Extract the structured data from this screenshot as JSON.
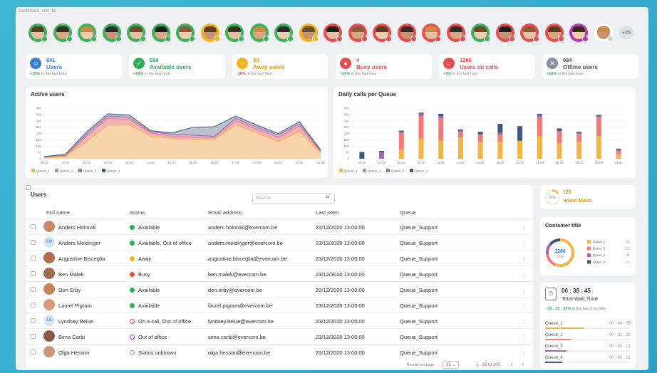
{
  "window_title": "Dashboard_v08_16",
  "avatar_more": "+25",
  "avatars": [
    {
      "status": "#3bb25a"
    },
    {
      "status": "#3bb25a"
    },
    {
      "status": "#3bb25a"
    },
    {
      "status": "#3bb25a"
    },
    {
      "status": "#3bb25a"
    },
    {
      "status": "#3bb25a"
    },
    {
      "status": "#3bb25a"
    },
    {
      "status": "#f1b31c"
    },
    {
      "status": "#3bb25a"
    },
    {
      "status": "#3bb25a"
    },
    {
      "status": "#3bb25a"
    },
    {
      "status": "#f1b31c"
    },
    {
      "status": "#e54e4e"
    },
    {
      "status": "#e54e4e"
    },
    {
      "status": "#e54e4e"
    },
    {
      "status": "#e54e4e"
    },
    {
      "status": "#e54e4e"
    },
    {
      "status": "#e54e4e"
    },
    {
      "status": "#3bb25a"
    },
    {
      "status": "#e54e4e"
    },
    {
      "status": "#e54e4e"
    },
    {
      "status": "#e54e4e"
    },
    {
      "status": "#b03bb2"
    },
    {
      "status": "#ffffff"
    }
  ],
  "stats": [
    {
      "num": "601",
      "label": "Users",
      "delta": "+10%",
      "sub": " in the last hour",
      "color": "#3a7bd5",
      "numcolor": "#3a7bd5",
      "icon": "user-icon",
      "glyph": "☺"
    },
    {
      "num": "598",
      "label": "Available users",
      "delta": "+10%",
      "sub": " in the last hour",
      "color": "#2fae5a",
      "numcolor": "#2fae5a",
      "icon": "check-icon",
      "glyph": "✓"
    },
    {
      "num": "30",
      "label": "Away users",
      "delta": "-10%",
      "sub": " in the last hour",
      "color": "#f3b51d",
      "numcolor": "#e09a0d",
      "icon": "clock-icon",
      "glyph": "◔"
    },
    {
      "num": "4",
      "label": "Busy users",
      "delta": "+10%",
      "sub": " in the last hour",
      "color": "#e84c4c",
      "numcolor": "#e84c4c",
      "icon": "busy-icon",
      "glyph": "●"
    },
    {
      "num": "1280",
      "label": "Users on calls",
      "delta": "+3%",
      "sub": " in the last hour",
      "color": "#e84c4c",
      "numcolor": "#e84c4c",
      "icon": "phone-ring-icon",
      "glyph": "○"
    },
    {
      "num": "984",
      "label": "Offline users",
      "delta": "+10%",
      "sub": " in the last hour",
      "color": "#8a8f99",
      "numcolor": "#555",
      "icon": "offline-icon",
      "glyph": "✕"
    }
  ],
  "active_users": {
    "title": "Active users",
    "chart_data": {
      "type": "area",
      "x": [
        "06:00",
        "07:00",
        "08:00",
        "09:00",
        "11:00",
        "13:00",
        "14:00",
        "15:00",
        "16:00",
        "17:00",
        "18:00",
        "19:00",
        "20:00",
        "21:00"
      ],
      "ylim": [
        0,
        450
      ],
      "yticks": [
        "400",
        "350",
        "300",
        "250",
        "200",
        "150",
        "100",
        "50",
        "0"
      ],
      "series": [
        {
          "name": "Queue_1",
          "color": "#f5b545",
          "values": [
            10,
            20,
            150,
            300,
            300,
            200,
            180,
            170,
            170,
            300,
            230,
            150,
            240,
            50
          ]
        },
        {
          "name": "Queue_2",
          "color": "#f47a7a",
          "values": [
            10,
            25,
            200,
            360,
            350,
            230,
            200,
            190,
            185,
            340,
            260,
            190,
            290,
            60
          ]
        },
        {
          "name": "Queue_3",
          "color": "#a566a8",
          "values": [
            15,
            30,
            220,
            380,
            370,
            240,
            220,
            210,
            200,
            360,
            280,
            210,
            310,
            70
          ]
        },
        {
          "name": "Queue_4",
          "color": "#3e5a7a",
          "values": [
            20,
            40,
            240,
            400,
            390,
            250,
            230,
            280,
            285,
            380,
            300,
            225,
            330,
            80
          ]
        }
      ]
    }
  },
  "daily_calls": {
    "title": "Daily calls per Queue",
    "chart_data": {
      "type": "bar",
      "categories": [
        "06:00",
        "07:00",
        "08:00",
        "09:00",
        "11:00",
        "13:00",
        "14:00",
        "15:00",
        "16:00",
        "17:00",
        "18:00",
        "19:00",
        "20:00",
        "21:00"
      ],
      "ylim": [
        0,
        450
      ],
      "yticks": [
        "400",
        "350",
        "300",
        "250",
        "200",
        "150",
        "100",
        "50",
        "0"
      ],
      "series": [
        {
          "name": "Queue_1",
          "color": "#f5b545",
          "values": [
            0,
            0,
            80,
            180,
            160,
            190,
            150,
            150,
            160,
            200,
            140,
            150,
            200,
            40
          ]
        },
        {
          "name": "Queue_2",
          "color": "#f47a7a",
          "values": [
            0,
            0,
            150,
            200,
            200,
            50,
            60,
            60,
            0,
            170,
            100,
            70,
            170,
            30
          ]
        },
        {
          "name": "Queue_3",
          "color": "#a566a8",
          "values": [
            0,
            60,
            10,
            20,
            20,
            10,
            10,
            20,
            0,
            20,
            10,
            10,
            10,
            10
          ]
        },
        {
          "name": "Queue_4",
          "color": "#3e5a7a",
          "values": [
            60,
            10,
            10,
            10,
            20,
            10,
            20,
            80,
            130,
            10,
            20,
            10,
            10,
            10
          ]
        }
      ]
    }
  },
  "users_table": {
    "title": "Users",
    "search_placeholder": "Search",
    "headers": [
      "Full name",
      "Status",
      "Email address",
      "Last seen",
      "Queue"
    ],
    "rows": [
      {
        "initials": "",
        "name": "Anders Holmvik",
        "status": "Available",
        "scolor": "#2fae5a",
        "email": "anders.holmvik@evercom.be",
        "seen": "23/12/2020 13:00:00",
        "queue": "Queue_Support"
      },
      {
        "initials": "AM",
        "name": "Anders Meidinger",
        "status": "Available, Out of office",
        "scolor": "#2fae5a",
        "email": "anders.meidinger@evercom.be",
        "seen": "23/12/2020 13:00:00",
        "queue": "Queue_Support"
      },
      {
        "initials": "",
        "name": "Augustine Bisceglia",
        "status": "Away",
        "scolor": "#f3b51d",
        "email": "augustine.bisceglia@evercom.be",
        "seen": "23/12/2020 13:00:00",
        "queue": "Queue_Support"
      },
      {
        "initials": "",
        "name": "Ben Malek",
        "status": "Busy",
        "scolor": "#e84c4c",
        "email": "ben.malek@evercom.be",
        "seen": "23/12/2020 13:00:00",
        "queue": "Queue_Support"
      },
      {
        "initials": "",
        "name": "Don Erby",
        "status": "Available",
        "scolor": "#2fae5a",
        "email": "don.erby@evercom.be",
        "seen": "23/12/2020 13:00:00",
        "queue": "Queue_Support"
      },
      {
        "initials": "",
        "name": "Laurel Pigram",
        "status": "Available",
        "scolor": "#2fae5a",
        "email": "laurel.pigram@evercom.be",
        "seen": "23/12/2020 13:00:00",
        "queue": "Queue_Support"
      },
      {
        "initials": "LB",
        "name": "Lyndsey Belue",
        "status": "On a call, Out of office",
        "scolor": "#e84c4c",
        "email": "lyndsey.belue@evercom.be",
        "seen": "23/12/2020 13:00:00",
        "queue": "Queue_Support"
      },
      {
        "initials": "",
        "name": "Sima Corbi",
        "status": "Out of office",
        "scolor": "#b03bb2",
        "email": "sima.corbi@evercom.be",
        "seen": "23/12/2020 13:00:00",
        "queue": "Queue_Support"
      },
      {
        "initials": "",
        "name": "Olga Hesson",
        "status": "Status unknown",
        "scolor": "#9aa0a8",
        "email": "olga.hesson@evercom.be",
        "seen": "23/12/2020 13:00:00",
        "queue": "Queue_Support"
      }
    ],
    "rows_per_page_label": "Results per page:",
    "rows_per_page": "25",
    "range": "1 - 25 of 100"
  },
  "voicemails": {
    "pct": "16%",
    "num": "123",
    "label": "Voice Mails"
  },
  "container": {
    "title": "Container title",
    "total": "1280",
    "total_label": "Calls",
    "chart_data": {
      "type": "pie",
      "series": [
        {
          "name": "Queue_1",
          "color": "#f5b545",
          "value": "700"
        },
        {
          "name": "Queue_2",
          "color": "#f47a7a",
          "value": "210"
        },
        {
          "name": "Queue_3",
          "color": "#a566a8",
          "value": "171"
        },
        {
          "name": "Queue_4",
          "color": "#3e5a7a",
          "value": "171"
        }
      ]
    }
  },
  "wait": {
    "time": "00 : 38 : 45",
    "label": "Total Wait Time",
    "delta": "- 00 : 35 : 37%",
    "delta_sub": " in the last 3 months",
    "queues": [
      {
        "name": "Queue_1",
        "time": "00 : 04 : 58",
        "color": "#f5b545",
        "pct": 0.45
      },
      {
        "name": "Queue_2",
        "time": "00 : 31 : 26",
        "color": "#f47a7a",
        "pct": 0.3
      },
      {
        "name": "Queue_3",
        "time": "00 : 03 : 21",
        "color": "#a566a8",
        "pct": 0.25
      },
      {
        "name": "Queue_4",
        "time": "00 : 03 : 21",
        "color": "#3e5a7a",
        "pct": 0.2
      }
    ]
  }
}
